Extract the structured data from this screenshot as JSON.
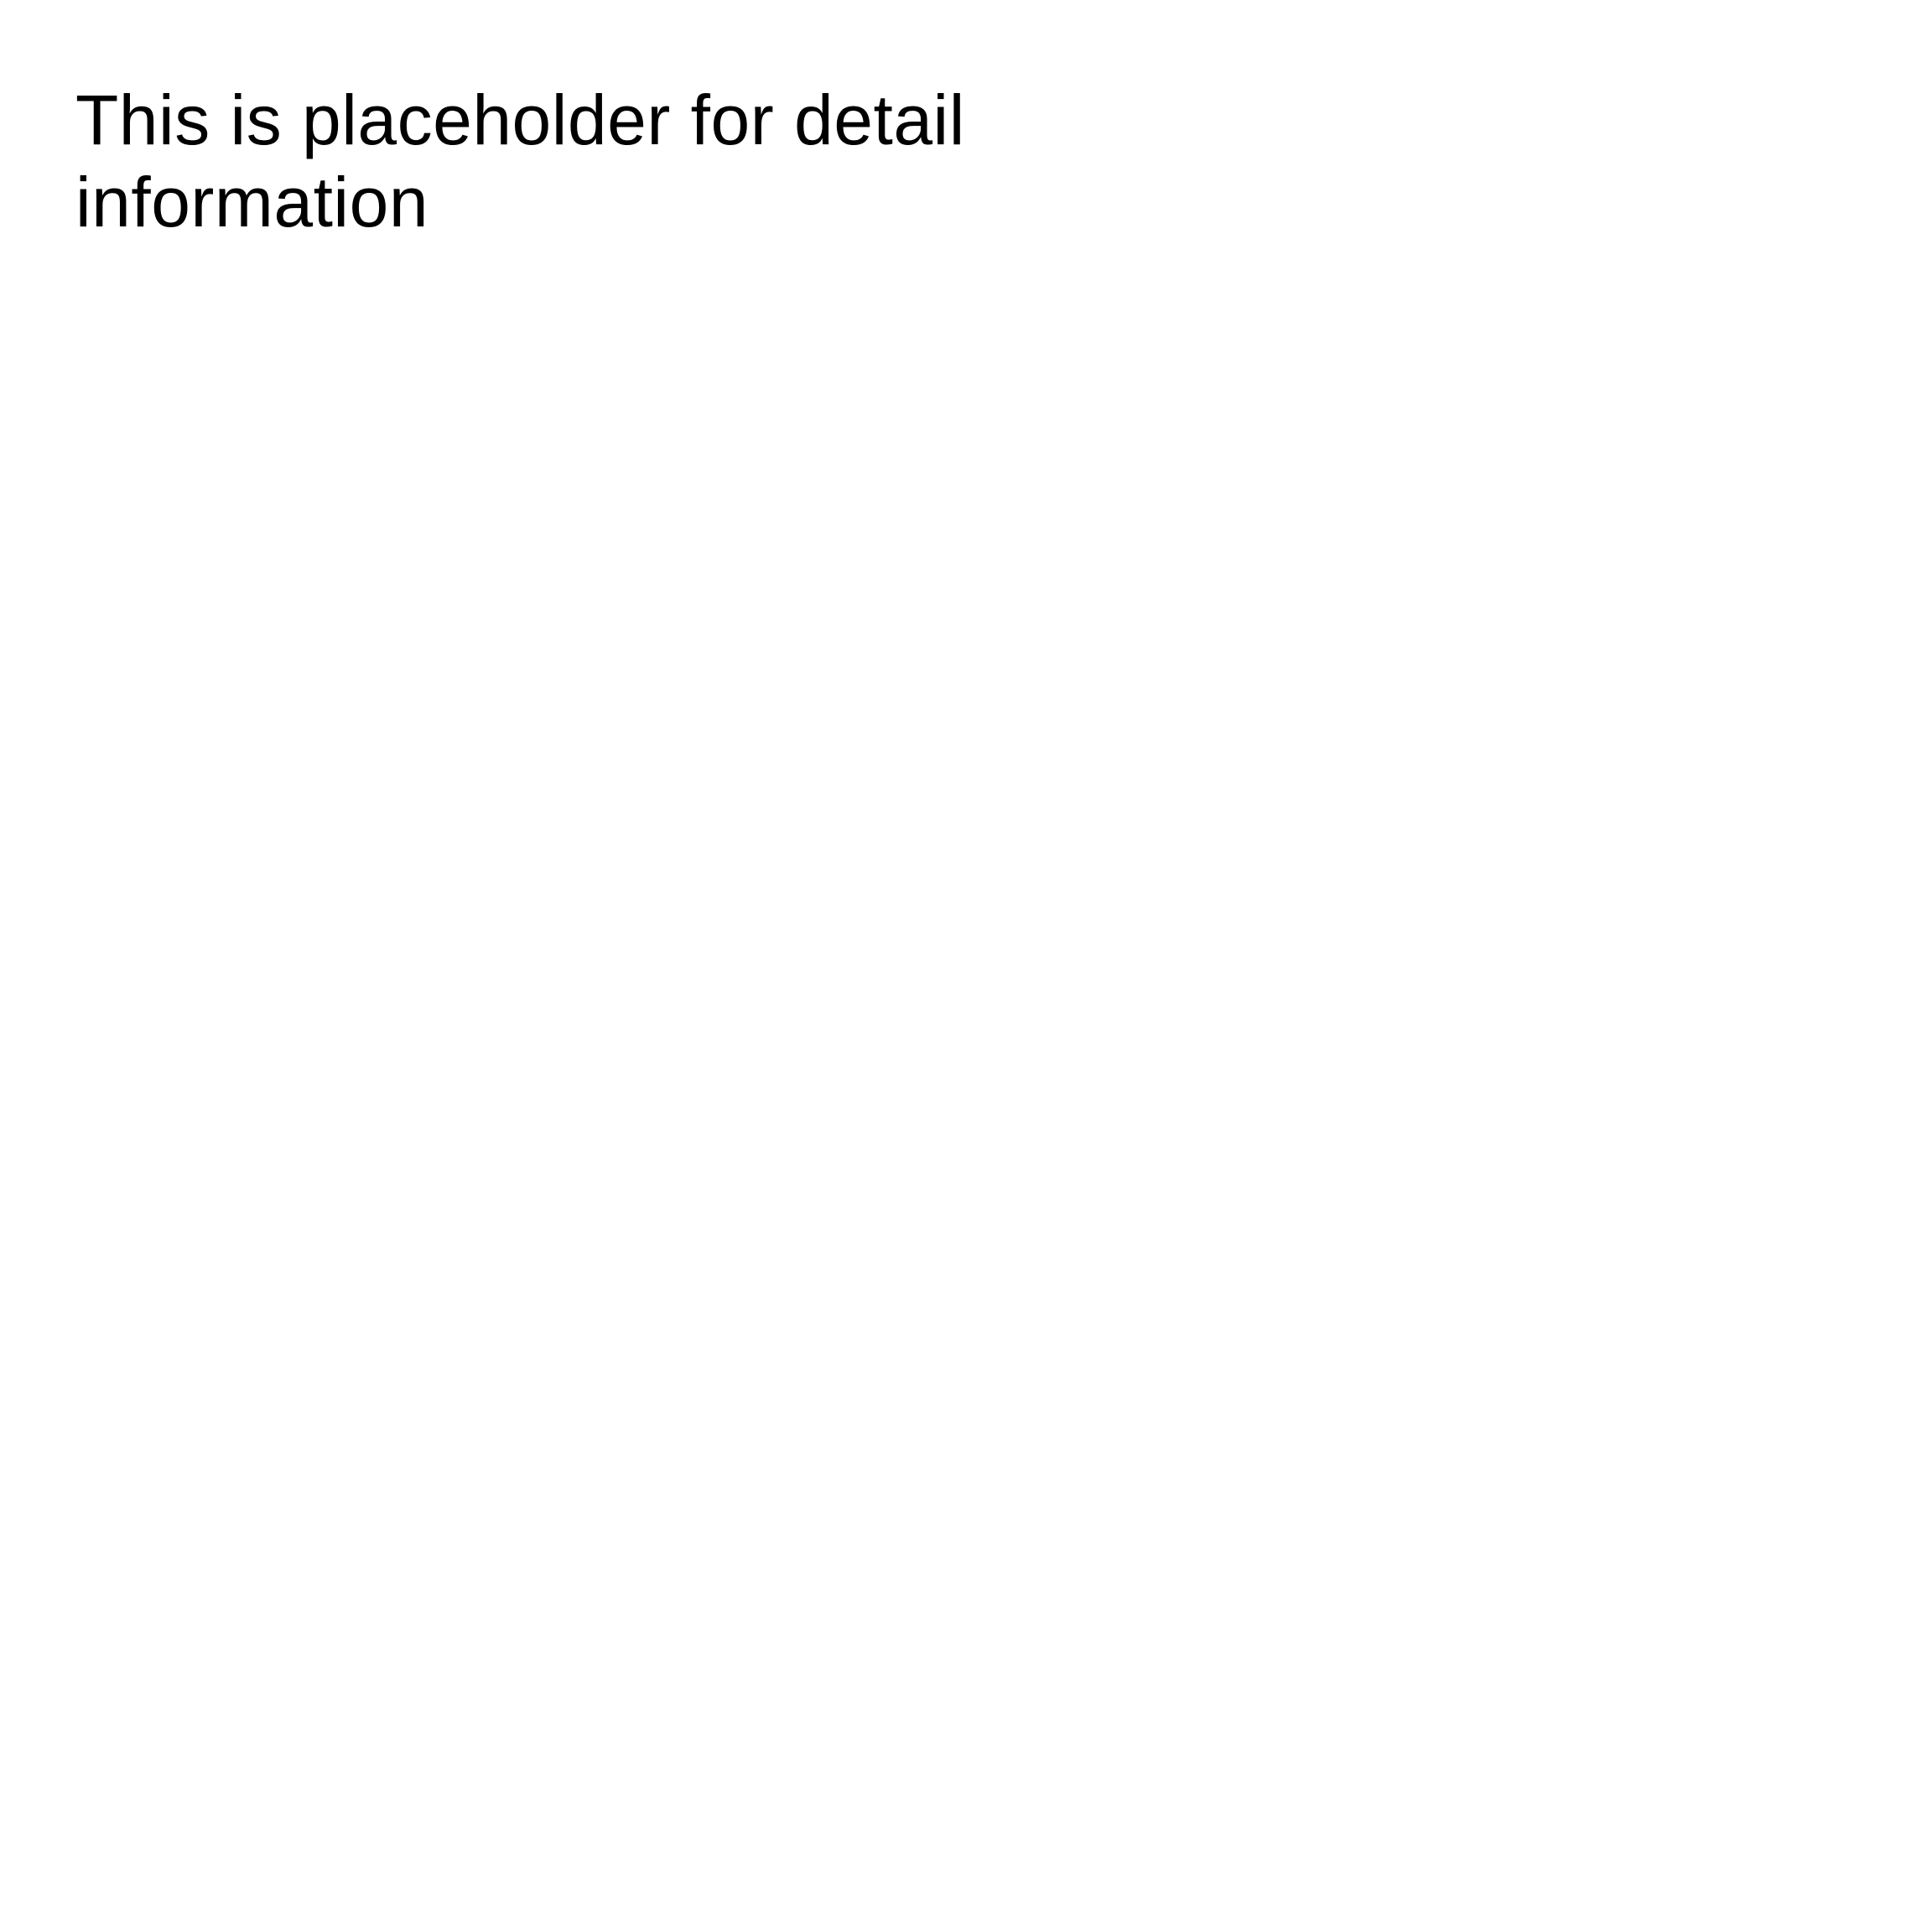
{
  "detail": {
    "placeholder_text": "This is placeholder for detail information"
  },
  "colors": {
    "background": "#ffffff",
    "text": "#000000"
  }
}
